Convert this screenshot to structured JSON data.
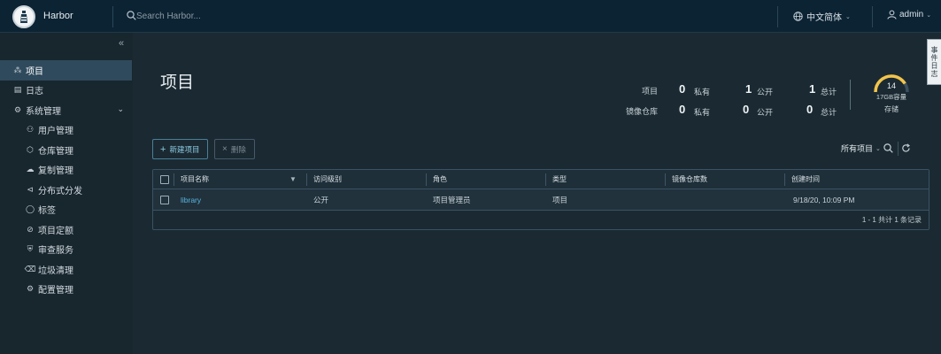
{
  "header": {
    "brand": "Harbor",
    "search_placeholder": "Search Harbor...",
    "language": "中文简体",
    "user": "admin"
  },
  "sidebar": {
    "items": [
      {
        "label": "项目",
        "icon": "projects-icon",
        "active": true
      },
      {
        "label": "日志",
        "icon": "logs-icon"
      },
      {
        "label": "系统管理",
        "icon": "admin-icon",
        "expanded": true
      },
      {
        "label": "用户管理",
        "icon": "users-icon"
      },
      {
        "label": "仓库管理",
        "icon": "registry-icon"
      },
      {
        "label": "复制管理",
        "icon": "replication-icon"
      },
      {
        "label": "分布式分发",
        "icon": "distribution-icon"
      },
      {
        "label": "标签",
        "icon": "tag-icon"
      },
      {
        "label": "项目定额",
        "icon": "quota-icon"
      },
      {
        "label": "审查服务",
        "icon": "shield-icon"
      },
      {
        "label": "垃圾清理",
        "icon": "trash-icon"
      },
      {
        "label": "配置管理",
        "icon": "gear-icon"
      }
    ]
  },
  "main": {
    "title": "项目",
    "stats": {
      "projects_label": "项目",
      "repos_label": "镜像仓库",
      "private_label": "私有",
      "public_label": "公开",
      "total_label": "总计",
      "projects_private": "0",
      "projects_public": "1",
      "projects_total": "1",
      "repos_private": "0",
      "repos_public": "0",
      "repos_total": "0"
    },
    "storage": {
      "used": "14",
      "capacity": "17GB容量",
      "label": "存储",
      "used_fraction": 0.82
    },
    "side_tab": "事件日志",
    "buttons": {
      "new": "新建项目",
      "delete": "删除"
    },
    "filter": "所有项目",
    "table": {
      "columns": [
        "项目名称",
        "访问级别",
        "角色",
        "类型",
        "镜像仓库数",
        "创建时间"
      ],
      "rows": [
        {
          "name": "library",
          "access": "公开",
          "role": "项目管理员",
          "type": "项目",
          "repo_count": "",
          "created": "9/18/20, 10:09 PM"
        }
      ],
      "footer": "1 - 1 共计 1 条记录"
    }
  },
  "colors": {
    "accent": "#57b5e0",
    "header_bg": "#0c2334",
    "body_bg": "#1b2a32",
    "gauge": "#f2c44b"
  }
}
